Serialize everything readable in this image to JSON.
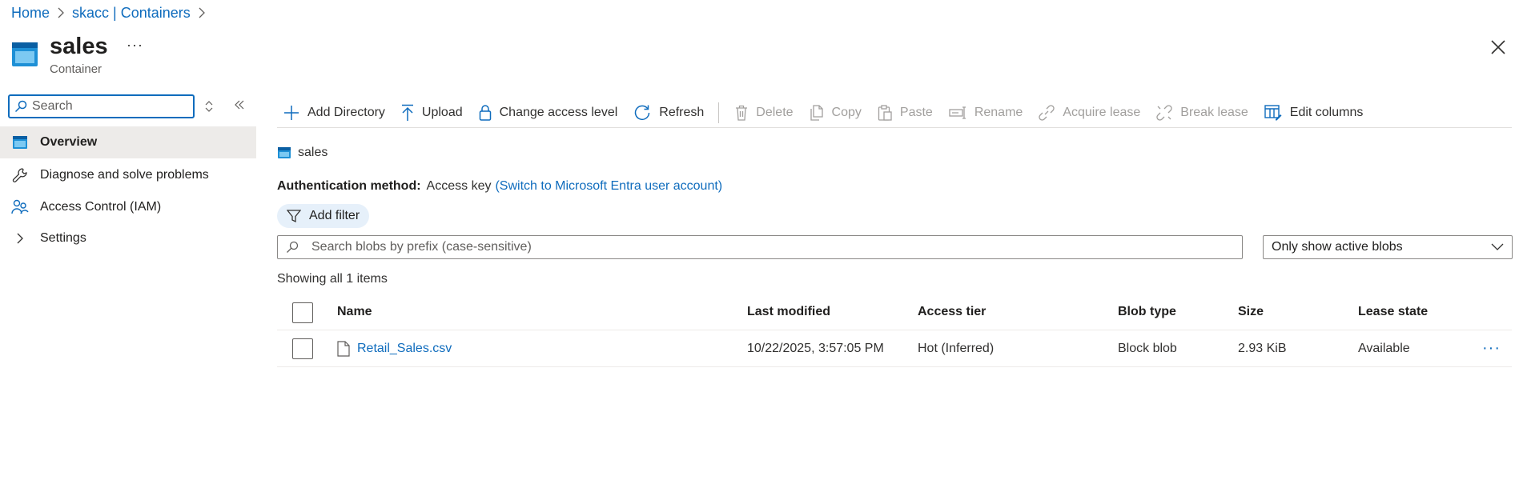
{
  "breadcrumb": {
    "home": "Home",
    "containers": "skacc | Containers"
  },
  "header": {
    "title": "sales",
    "subtitle": "Container",
    "more": "···"
  },
  "nav": {
    "search_placeholder": "Search",
    "items": [
      {
        "label": "Overview",
        "icon": "container-icon"
      },
      {
        "label": "Diagnose and solve problems",
        "icon": "wrench-icon"
      },
      {
        "label": "Access Control (IAM)",
        "icon": "people-icon"
      },
      {
        "label": "Settings",
        "icon": "chevron-right-icon"
      }
    ]
  },
  "toolbar": {
    "add_directory": "Add Directory",
    "upload": "Upload",
    "change_access": "Change access level",
    "refresh": "Refresh",
    "delete": "Delete",
    "copy": "Copy",
    "paste": "Paste",
    "rename": "Rename",
    "acquire_lease": "Acquire lease",
    "break_lease": "Break lease",
    "edit_columns": "Edit columns"
  },
  "content": {
    "path_label": "sales",
    "auth_label": "Authentication method:",
    "auth_value": "Access key",
    "auth_switch": "(Switch to Microsoft Entra user account)",
    "add_filter": "Add filter",
    "blob_search_placeholder": "Search blobs by prefix (case-sensitive)",
    "blob_filter_selected": "Only show active blobs",
    "showing": "Showing all 1 items"
  },
  "table": {
    "headers": {
      "name": "Name",
      "modified": "Last modified",
      "tier": "Access tier",
      "type": "Blob type",
      "size": "Size",
      "lease": "Lease state"
    },
    "rows": [
      {
        "name": "Retail_Sales.csv",
        "modified": "10/22/2025, 3:57:05 PM",
        "tier": "Hot (Inferred)",
        "type": "Block blob",
        "size": "2.93 KiB",
        "lease": "Available",
        "more": "···"
      }
    ]
  },
  "colors": {
    "accent": "#0f6cbd",
    "disabled": "#a19f9d",
    "nav_active": "#edebe9",
    "filter_pill": "#e6f0fa"
  }
}
